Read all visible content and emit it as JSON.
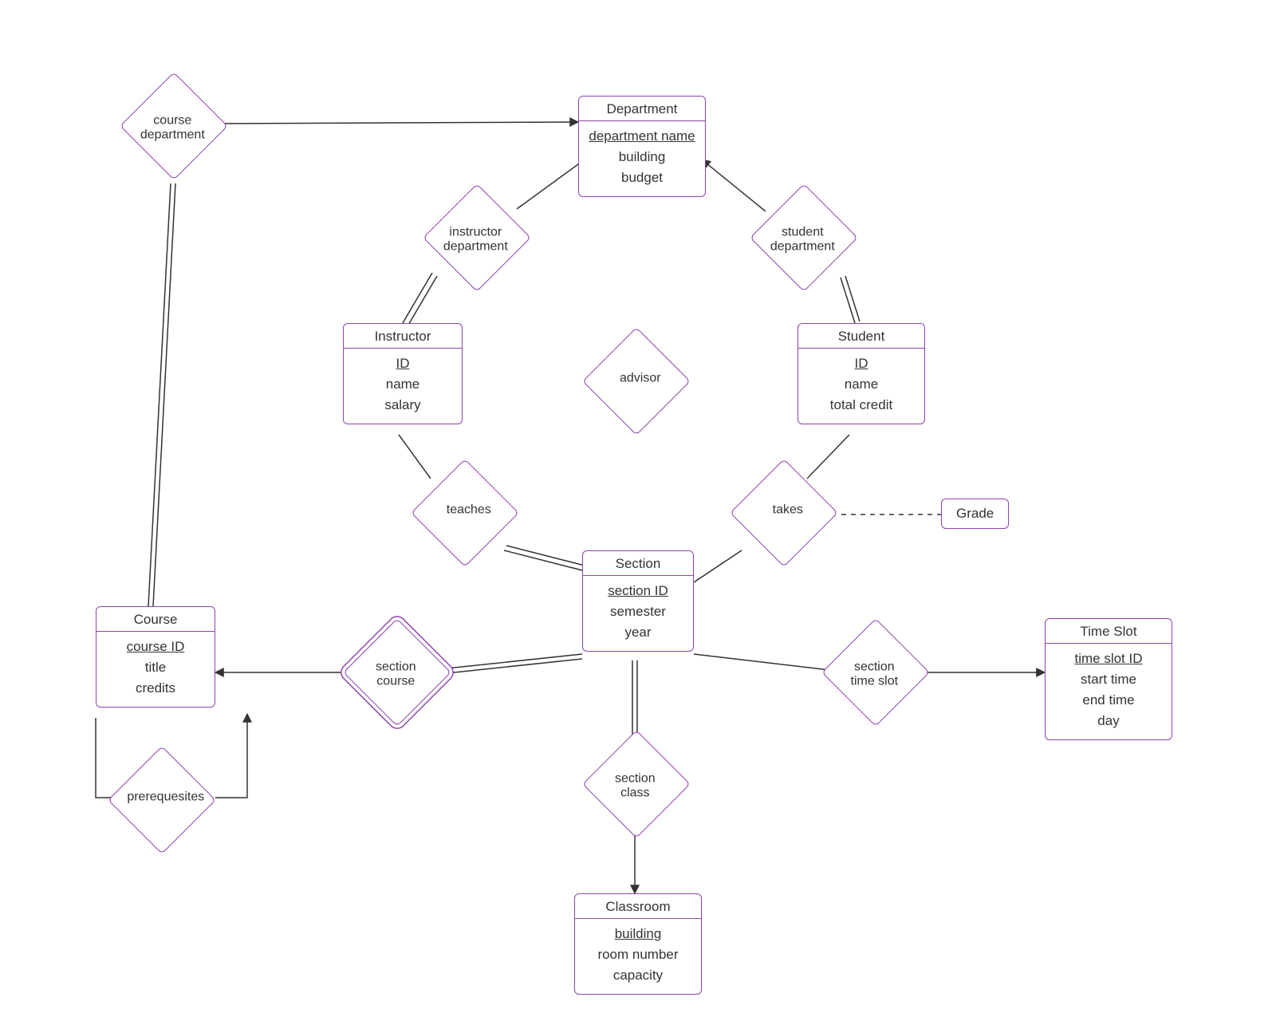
{
  "entities": {
    "department": {
      "title": "Department",
      "attrs": [
        "department name",
        "building",
        "budget"
      ],
      "keys": [
        0
      ]
    },
    "instructor": {
      "title": "Instructor",
      "attrs": [
        "ID",
        "name",
        "salary"
      ],
      "keys": [
        0
      ]
    },
    "student": {
      "title": "Student",
      "attrs": [
        "ID",
        "name",
        "total credit"
      ],
      "keys": [
        0
      ]
    },
    "section": {
      "title": "Section",
      "attrs": [
        "section ID",
        "semester",
        "year"
      ],
      "keys": [
        0
      ]
    },
    "course": {
      "title": "Course",
      "attrs": [
        "course ID",
        "title",
        "credits"
      ],
      "keys": [
        0
      ]
    },
    "classroom": {
      "title": "Classroom",
      "attrs": [
        "building",
        "room number",
        "capacity"
      ],
      "keys": [
        0
      ]
    },
    "timeslot": {
      "title": "Time Slot",
      "attrs": [
        "time slot ID",
        "start time",
        "end time",
        "day"
      ],
      "keys": [
        0
      ]
    }
  },
  "relationships": {
    "course_department": "course\ndepartment",
    "instructor_department": "instructor\ndepartment",
    "student_department": "student\ndepartment",
    "advisor": "advisor",
    "teaches": "teaches",
    "takes": "takes",
    "section_course": "section\ncourse",
    "section_class": "section\nclass",
    "section_timeslot": "section\ntime slot",
    "prerequisites": "prerequesites"
  },
  "assoc": {
    "grade": "Grade"
  }
}
